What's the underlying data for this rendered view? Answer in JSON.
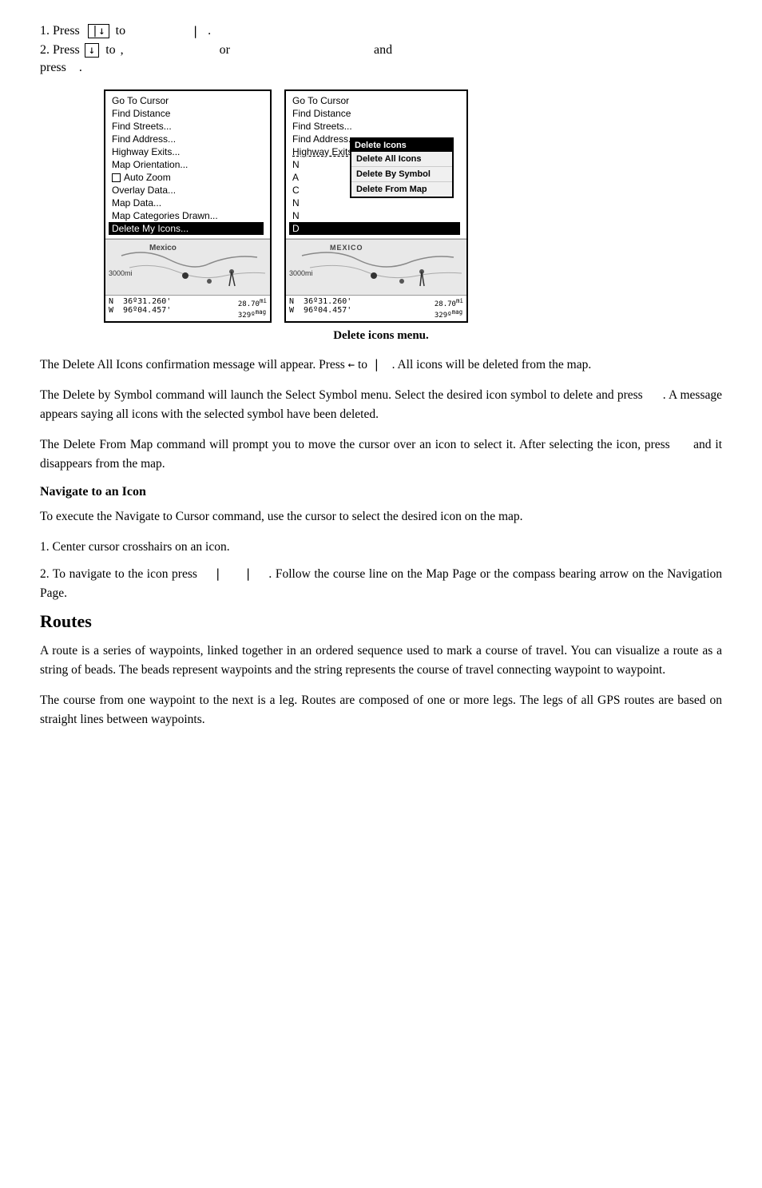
{
  "page": {
    "line1_prefix": "1. Press",
    "line1_button": "↓",
    "line1_mid": "to",
    "line1_pipe": "|",
    "line1_dot": ".",
    "line2_prefix": "2. Press",
    "line2_button": "↓",
    "line2_to": "to",
    "line2_comma": ",",
    "line2_or": "or",
    "line2_and": "and",
    "line_press": "press",
    "line_press_dot": ".",
    "left_menu": {
      "items": [
        "Go To Cursor",
        "Find Distance",
        "Find Streets...",
        "Find Address...",
        "Highway Exits...",
        "Map Orientation...",
        "Auto Zoom",
        "Overlay Data...",
        "Map Data...",
        "Map Categories Drawn...",
        "Delete My Icons..."
      ],
      "selected_item": "Delete My Icons...",
      "checkbox_item": "Auto Zoom",
      "mexico_label": "Mexico",
      "scale": "3000mi",
      "coords_n": "36º31.260'",
      "coords_w": "96º04.457'",
      "coords_heading": "28.70",
      "coords_heading_unit": "mi",
      "coords_mag": "329º",
      "coords_mag_unit": "mag"
    },
    "right_menu": {
      "items": [
        "Go To Cursor",
        "Find Distance",
        "Find Streets...",
        "Find Address...",
        "Highway Exits"
      ],
      "popup_title": "Delete Icons",
      "popup_items": [
        "Delete All Icons",
        "Delete By Symbol",
        "Delete From Map"
      ],
      "mexico_label": "MEXICO",
      "scale": "3000mi",
      "coords_n": "36º31.260'",
      "coords_w": "96º04.457'",
      "coords_heading": "28.70",
      "coords_heading_unit": "mi",
      "coords_mag": "329º",
      "coords_mag_unit": "mag"
    },
    "caption": "Delete icons menu.",
    "para1": "The Delete All Icons confirmation message will appear. Press ← to | . All icons will be deleted from the map.",
    "para2": "The Delete by Symbol command will launch the Select Symbol menu. Select the desired icon symbol to delete and press . A message appears saying all icons with the selected symbol have been deleted.",
    "para3": "The Delete From Map command will prompt you to move the cursor over an icon to select it. After selecting the icon, press and it disappears from the map.",
    "section_heading": "Navigate to an Icon",
    "para4": "To execute the Navigate to Cursor command, use the cursor to select the desired icon on the map.",
    "numbered1": "1. Center cursor crosshairs on an icon.",
    "numbered2_prefix": "2. To navigate to the icon press",
    "numbered2_pipes": "| |",
    "numbered2_suffix": ". Follow the course line on the Map Page or the compass bearing arrow on the Navigation Page.",
    "big_heading": "Routes",
    "para5": "A route is a series of waypoints, linked together in an ordered sequence used to mark a course of travel. You can visualize a route as a string of beads. The beads represent waypoints and the string represents the course of travel connecting waypoint to waypoint.",
    "para6": "The course from one waypoint to the next is a leg. Routes are composed of one or more legs. The legs of all GPS routes are based on straight lines between waypoints."
  }
}
